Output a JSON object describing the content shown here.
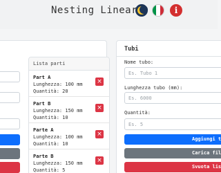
{
  "header": {
    "title": "Nesting Lineare",
    "icons": [
      "moon-icon",
      "italy-flag-icon",
      "info-icon"
    ],
    "info_glyph": "i"
  },
  "parts_list": {
    "heading": "Lista parti",
    "delete_glyph": "×",
    "items": [
      {
        "name": "Part A",
        "length": "Lunghezza: 100 mm",
        "quantity": "Quantità: 20"
      },
      {
        "name": "Part B",
        "length": "Lunghezza: 150 mm",
        "quantity": "Quantità: 10"
      },
      {
        "name": "Parte A",
        "length": "Lunghezza: 100 mm",
        "quantity": "Quantità: 10"
      },
      {
        "name": "Parte B",
        "length": "Lunghezza: 150 mm",
        "quantity": "Quantità: 5"
      }
    ]
  },
  "tubes": {
    "title": "Tubi",
    "name_label": "Nome tubo:",
    "name_placeholder": "Es. Tubo 1",
    "length_label": "Lunghezza tubo (mm):",
    "length_placeholder": "Es. 6000",
    "quantity_label": "Quantità:",
    "quantity_placeholder": "Es. 5",
    "add_button": "Aggiungi tubo",
    "load_button": "Carica file",
    "clear_button": "Svuota lista"
  },
  "colors": {
    "primary": "#0d6efd",
    "secondary": "#6c757d",
    "danger": "#dc3545"
  }
}
